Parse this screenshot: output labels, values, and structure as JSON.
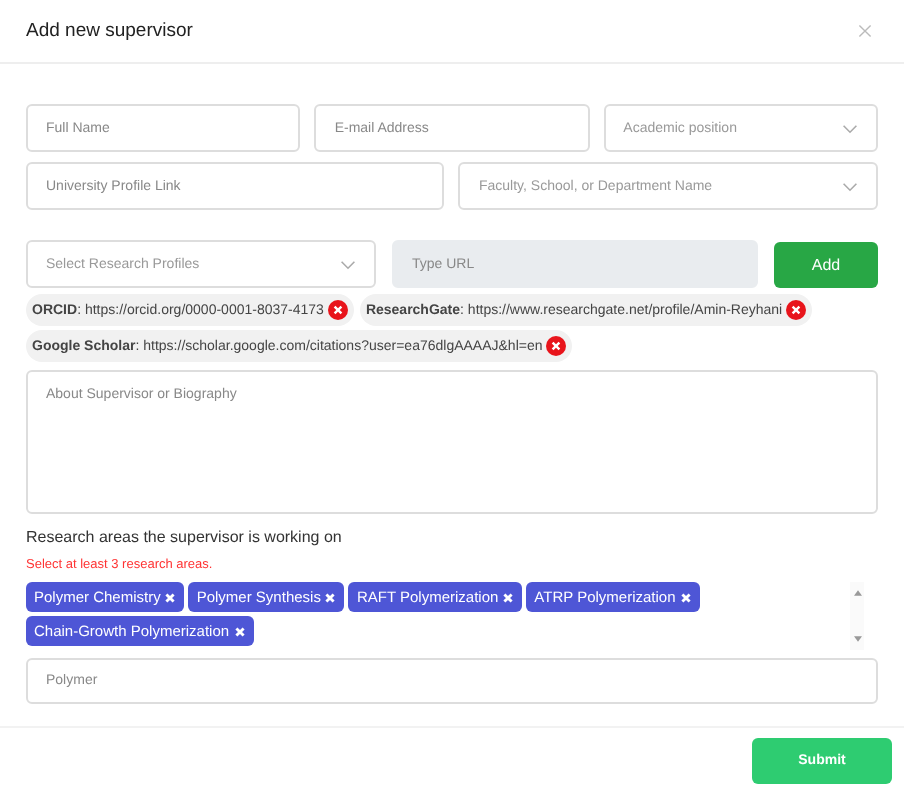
{
  "dialog": {
    "title": "Add new supervisor"
  },
  "fields": [
    {
      "kind": "text",
      "placeholder": "Full Name"
    },
    {
      "kind": "text",
      "placeholder": "E-mail Address"
    },
    {
      "kind": "select",
      "placeholder": "Academic position"
    },
    {
      "kind": "text",
      "placeholder": "University Profile Link"
    },
    {
      "kind": "select",
      "placeholder": "Faculty, School, or Department Name"
    }
  ],
  "profiles": {
    "select_placeholder": "Select Research Profiles",
    "url_placeholder": "Type URL",
    "add_button": "Add",
    "links": [
      "**ORCID**: https://orcid.org/0000-0001-8037-4173",
      "**ResearchGate**: https://www.researchgate.net/profile/Amin-Reyhani",
      "**Google Scholar**: https://scholar.google.com/citations?user=ea76dlgAAAAJ&hl=en"
    ]
  },
  "biography": {
    "placeholder": "About Supervisor or Biography"
  },
  "research_areas": {
    "label": "Research areas the supervisor is working on",
    "hint": "Select at least 3 research areas.",
    "tags": [
      "Polymer Chemistry",
      "Polymer Synthesis",
      "RAFT Polymerization",
      "ATRP Polymerization",
      "Chain-Growth Polymerization"
    ],
    "input_placeholder": "Polymer"
  },
  "submit_button": "Submit"
}
